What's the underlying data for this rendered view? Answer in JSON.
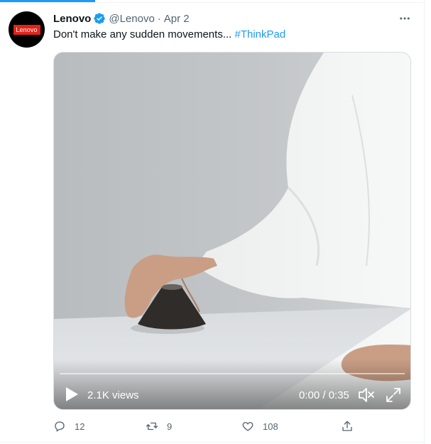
{
  "tweet": {
    "author_name": "Lenovo",
    "handle": "@Lenovo",
    "separator": "·",
    "date": "Apr 2",
    "avatar_logo_text": "Lenovo",
    "text": "Don't make any sudden movements... ",
    "hashtag": "#ThinkPad"
  },
  "video": {
    "views": "2.1K views",
    "time": "0:00 / 0:35"
  },
  "actions": {
    "reply_count": "12",
    "retweet_count": "9",
    "like_count": "108"
  },
  "colors": {
    "accent": "#1d9bf0",
    "muted_text": "#536471",
    "brand_red": "#e2231a"
  },
  "icons": [
    "verified-badge-icon",
    "more-icon",
    "play-icon",
    "volume-muted-icon",
    "fullscreen-icon",
    "reply-icon",
    "retweet-icon",
    "like-icon",
    "share-icon"
  ]
}
